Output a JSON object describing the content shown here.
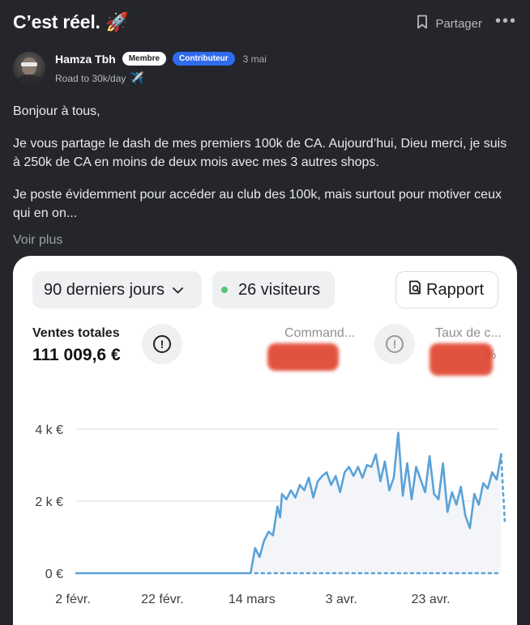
{
  "post": {
    "title": "C’est réel.",
    "title_emoji": "🚀",
    "share_label": "Partager",
    "more_label": "•••"
  },
  "author": {
    "name": "Hamza Tbh",
    "badge_member": "Membre",
    "badge_contributor": "Contributeur",
    "date": "3 mai",
    "tagline": "Road to 30k/day",
    "tagline_emoji": "✈️"
  },
  "body": {
    "paragraphs": [
      "Bonjour à tous,",
      "Je vous partage le dash de mes premiers 100k de CA. Aujourd’hui, Dieu merci, je suis à 250k de CA en moins de deux mois avec mes 3 autres shops.",
      "Je poste évidemment pour accéder au club des 100k, mais surtout pour motiver ceux qui en on..."
    ],
    "see_more": "Voir plus"
  },
  "dashboard": {
    "range_label": "90 derniers jours",
    "visitors_label": "26 visiteurs",
    "report_label": "Rapport",
    "total_sales_label": "Ventes totales",
    "total_sales_value": "111 009,6 €",
    "orders_label": "Command...",
    "conversion_label": "Taux de c...",
    "conversion_suffix": "%",
    "visitor_dot_color": "#54c47b",
    "redaction_color": "#e0452f"
  },
  "chart_data": {
    "type": "line",
    "title": "",
    "xlabel": "",
    "ylabel": "",
    "y_ticks": [
      "0 €",
      "2 k €",
      "4 k €"
    ],
    "ylim": [
      0,
      4500
    ],
    "x_tick_labels": [
      "2 févr.",
      "22 févr.",
      "14 mars",
      "3 avr.",
      "23 avr."
    ],
    "x_tick_days": [
      0,
      20,
      40,
      60,
      80
    ],
    "grid": true,
    "line_color": "#5aa2d8",
    "series": [
      {
        "style": "solid",
        "points": [
          [
            0,
            0
          ],
          [
            5,
            0
          ],
          [
            10,
            0
          ],
          [
            15,
            0
          ],
          [
            20,
            0
          ],
          [
            25,
            0
          ],
          [
            30,
            0
          ],
          [
            35,
            0
          ],
          [
            39,
            0
          ],
          [
            40,
            700
          ],
          [
            41,
            450
          ],
          [
            42,
            900
          ],
          [
            43,
            1150
          ],
          [
            44,
            1050
          ],
          [
            45,
            1850
          ],
          [
            45.6,
            1550
          ],
          [
            46,
            2200
          ],
          [
            47,
            2050
          ],
          [
            48,
            2300
          ],
          [
            49,
            2100
          ],
          [
            50,
            2450
          ],
          [
            51,
            2300
          ],
          [
            52,
            2650
          ],
          [
            53,
            2100
          ],
          [
            54,
            2550
          ],
          [
            55,
            2700
          ],
          [
            56,
            2800
          ],
          [
            57,
            2450
          ],
          [
            58,
            2700
          ],
          [
            59,
            2250
          ],
          [
            60,
            2800
          ],
          [
            61,
            2950
          ],
          [
            62,
            2700
          ],
          [
            63,
            2950
          ],
          [
            64,
            2650
          ],
          [
            65,
            3000
          ],
          [
            66,
            2950
          ],
          [
            67,
            3300
          ],
          [
            68,
            2550
          ],
          [
            69,
            3100
          ],
          [
            70,
            2300
          ],
          [
            71,
            2650
          ],
          [
            72,
            3900
          ],
          [
            73,
            2150
          ],
          [
            74,
            3050
          ],
          [
            75,
            2050
          ],
          [
            76,
            2950
          ],
          [
            77,
            2600
          ],
          [
            78,
            2250
          ],
          [
            79,
            3250
          ],
          [
            80,
            2200
          ],
          [
            81,
            2050
          ],
          [
            82,
            3050
          ],
          [
            83,
            1700
          ],
          [
            84,
            2250
          ],
          [
            85,
            1900
          ],
          [
            86,
            2400
          ],
          [
            87,
            1600
          ],
          [
            88,
            1250
          ],
          [
            89,
            2200
          ],
          [
            90,
            1900
          ],
          [
            91,
            2500
          ],
          [
            92,
            2350
          ],
          [
            93,
            2800
          ],
          [
            94,
            2600
          ],
          [
            95,
            3300
          ]
        ]
      },
      {
        "style": "dotted",
        "points": [
          [
            40,
            0
          ],
          [
            50,
            0
          ],
          [
            60,
            0
          ],
          [
            70,
            0
          ],
          [
            80,
            0
          ],
          [
            90,
            0
          ],
          [
            95,
            0
          ]
        ]
      },
      {
        "style": "dotted",
        "points": [
          [
            95,
            3300
          ],
          [
            95.2,
            2800
          ],
          [
            95.4,
            2300
          ],
          [
            95.6,
            1950
          ],
          [
            95.8,
            1450
          ]
        ]
      }
    ]
  }
}
